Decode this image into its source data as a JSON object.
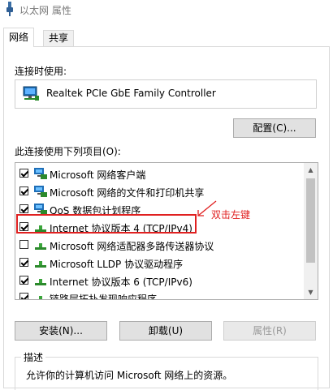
{
  "window": {
    "title": "以太网 属性",
    "icon": "network-adapter-icon"
  },
  "tabs": [
    {
      "label": "网络",
      "active": true
    },
    {
      "label": "共享",
      "active": false
    }
  ],
  "connect_using_label": "连接时使用:",
  "adapter": {
    "name": "Realtek PCIe GbE Family Controller",
    "icon": "network-adapter-icon"
  },
  "configure_button": "配置(C)...",
  "items_label": "此连接使用下列项目(O):",
  "items": [
    {
      "label": "Microsoft 网络客户端",
      "checked": true,
      "icon": "network-client-icon"
    },
    {
      "label": "Microsoft 网络的文件和打印机共享",
      "checked": true,
      "icon": "network-client-icon"
    },
    {
      "label": "QoS 数据包计划程序",
      "checked": true,
      "icon": "network-client-icon"
    },
    {
      "label": "Internet 协议版本 4 (TCP/IPv4)",
      "checked": true,
      "icon": "protocol-icon"
    },
    {
      "label": "Microsoft 网络适配器多路传送器协议",
      "checked": false,
      "icon": "protocol-icon"
    },
    {
      "label": "Microsoft LLDP 协议驱动程序",
      "checked": true,
      "icon": "protocol-icon"
    },
    {
      "label": "Internet 协议版本 6 (TCP/IPv6)",
      "checked": true,
      "icon": "protocol-icon"
    },
    {
      "label": "链路层拓扑发现响应程序",
      "checked": true,
      "icon": "protocol-icon"
    }
  ],
  "annotation": {
    "text": "双击左键",
    "color": "#e02020"
  },
  "buttons": {
    "install": "安装(N)...",
    "uninstall": "卸载(U)",
    "properties": "属性(R)"
  },
  "description": {
    "legend": "描述",
    "text": "允许你的计算机访问 Microsoft 网络上的资源。"
  }
}
